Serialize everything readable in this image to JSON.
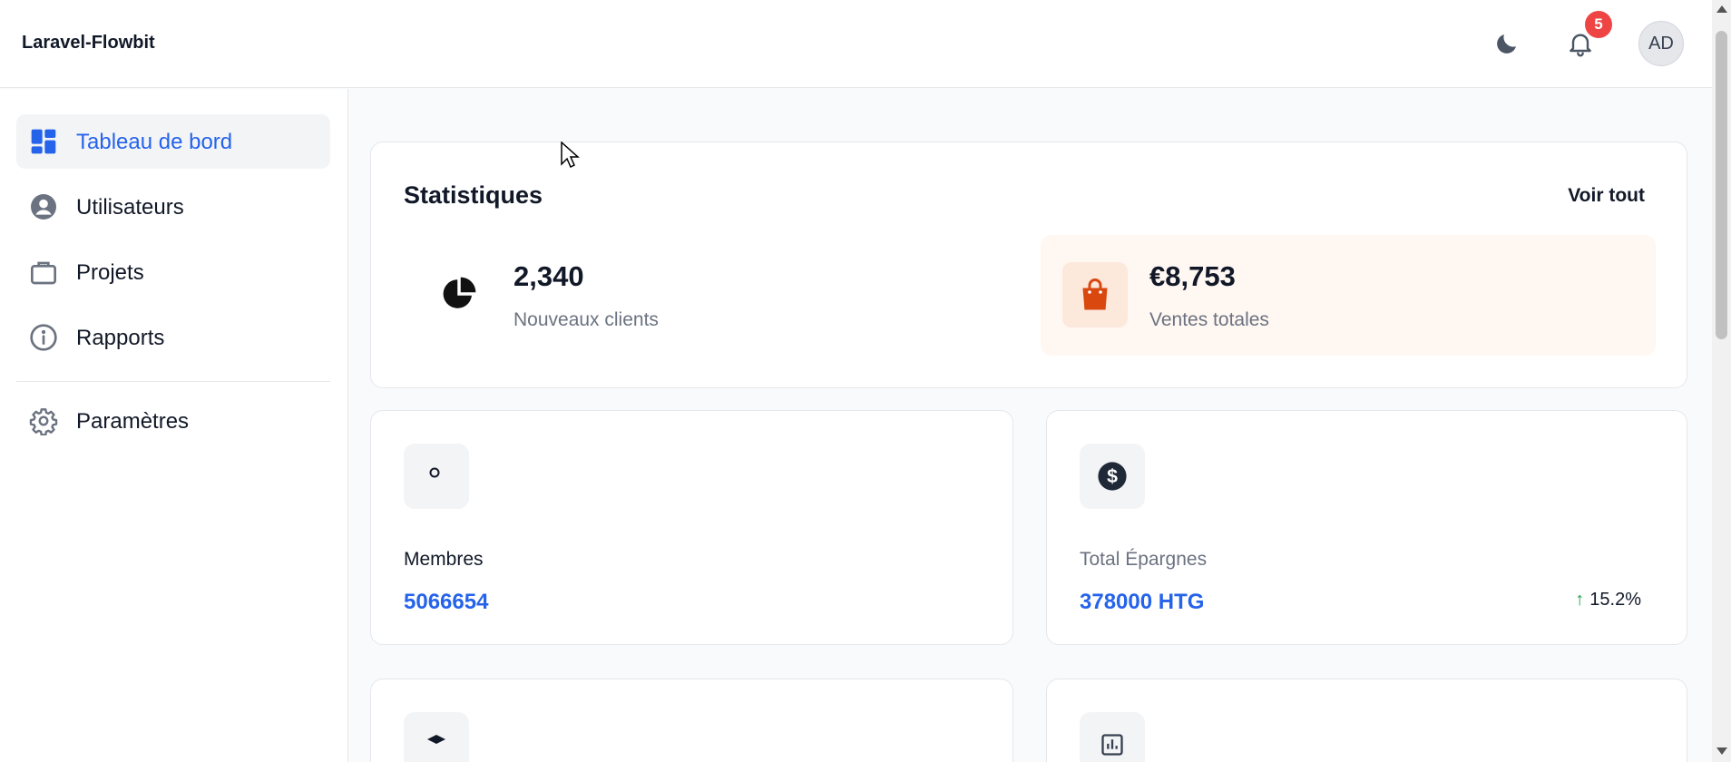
{
  "app": {
    "brand": "Laravel-Flowbit"
  },
  "header": {
    "notification_count": "5",
    "avatar_initials": "AD"
  },
  "sidebar": {
    "items": [
      {
        "label": "Tableau de bord",
        "icon": "dashboard-icon",
        "active": true
      },
      {
        "label": "Utilisateurs",
        "icon": "user-circle-icon"
      },
      {
        "label": "Projets",
        "icon": "briefcase-icon"
      },
      {
        "label": "Rapports",
        "icon": "info-icon"
      },
      {
        "label": "Paramètres",
        "icon": "gear-icon"
      }
    ]
  },
  "stats": {
    "title": "Statistiques",
    "view_all": "Voir tout",
    "new_clients": {
      "value": "2,340",
      "label": "Nouveaux clients",
      "icon": "pie-chart-icon"
    },
    "total_sales": {
      "value": "€8,753",
      "label": "Ventes totales",
      "icon": "shopping-bag-icon"
    }
  },
  "metrics": {
    "members": {
      "label": "Membres",
      "value": "5066654",
      "icon": "user-icon"
    },
    "savings": {
      "label": "Total Épargnes",
      "value": "378000 HTG",
      "trend": "15.2%",
      "icon": "dollar-icon"
    }
  },
  "colors": {
    "accent": "#2563eb",
    "sales_bg": "#fff7f2",
    "sales_icon": "#d9480f",
    "badge": "#ef4444",
    "trend_up": "#16a34a"
  }
}
